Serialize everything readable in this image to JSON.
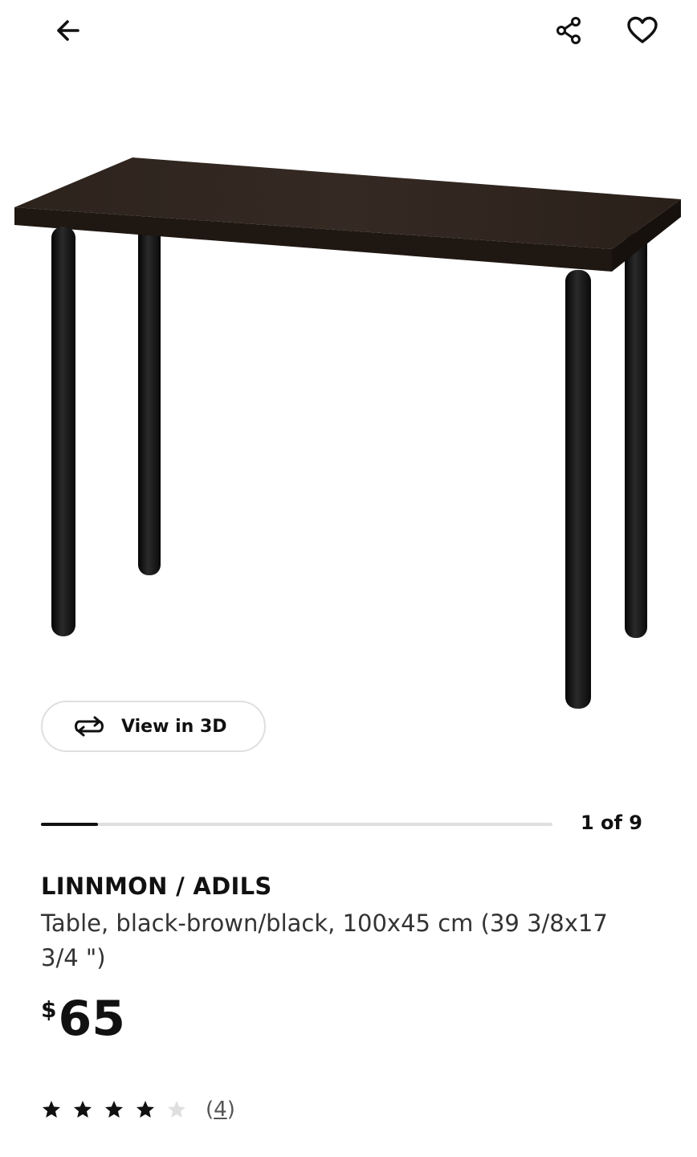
{
  "header": {
    "back_icon": "arrow-left-icon",
    "share_icon": "share-icon",
    "favorite_icon": "heart-outline-icon"
  },
  "gallery": {
    "view3d_label": "View in 3D",
    "view3d_icon": "rotate-icon",
    "current_image": 1,
    "total_images": 9,
    "counter_text": "1 of 9",
    "progress_fraction": 0.111
  },
  "product": {
    "name": "LINNMON / ADILS",
    "description": "Table, black-brown/black, 100x45 cm (39 3/8x17 3/4 \")",
    "currency": "$",
    "price": "65",
    "rating": 4,
    "rating_max": 5,
    "review_count": "4"
  },
  "colors": {
    "accent": "#111111",
    "table_top": "#2b211b",
    "legs": "#151515",
    "star_filled": "#111111",
    "star_empty": "#dfdfdf"
  }
}
